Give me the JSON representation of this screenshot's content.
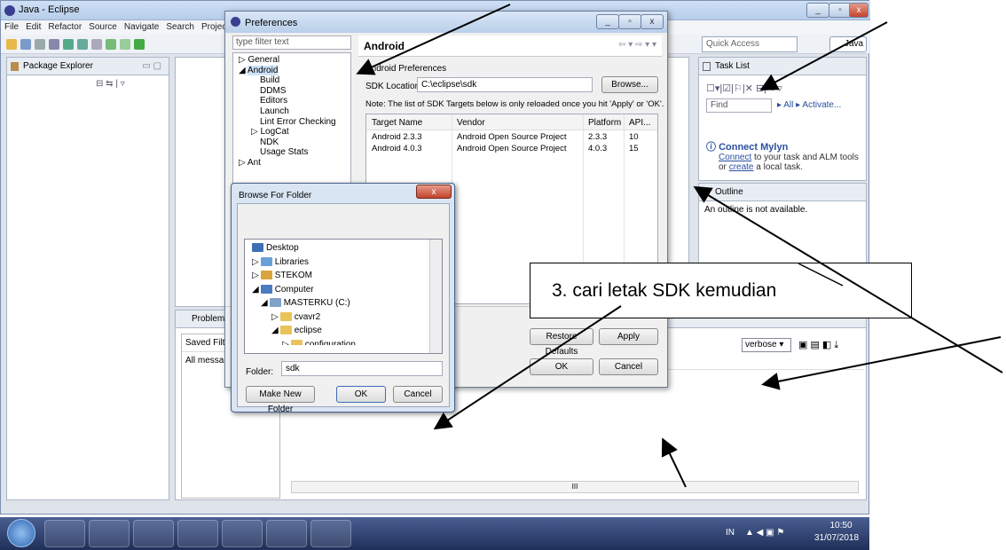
{
  "eclipse": {
    "title": "Java - Eclipse",
    "menu": [
      "File",
      "Edit",
      "Refactor",
      "Source",
      "Navigate",
      "Search",
      "Projec"
    ],
    "quick_access": "Quick Access",
    "perspective": "Java"
  },
  "views": {
    "package_explorer": "Package Explorer",
    "task_list": "Task List",
    "find_placeholder": "Find",
    "all": "All",
    "activate": "Activate...",
    "mylyn_title": "Connect Mylyn",
    "mylyn_link1": "Connect",
    "mylyn_text1": " to your task and ALM tools or",
    "mylyn_link2": "create",
    "mylyn_text2": " a local task.",
    "outline": "Outline",
    "outline_msg": "An outline is not available.",
    "problems": "Problems",
    "saved_filter": "Saved Filte",
    "all_messages": "All messa",
    "verbose": "verbose",
    "scroll_mark": "III"
  },
  "preferences": {
    "title": "Preferences",
    "filter_placeholder": "type filter text",
    "tree": [
      "General",
      "Android",
      "Build",
      "DDMS",
      "Editors",
      "Launch",
      "Lint Error Checking",
      "LogCat",
      "NDK",
      "Usage Stats",
      "Ant"
    ],
    "page_title": "Android",
    "section": "Android Preferences",
    "sdk_label": "SDK Location:",
    "sdk_value": "C:\\eclipse\\sdk",
    "browse": "Browse...",
    "note": "Note: The list of SDK Targets below is only reloaded once you hit 'Apply' or 'OK'.",
    "columns": [
      "Target Name",
      "Vendor",
      "Platform",
      "API..."
    ],
    "rows": [
      [
        "Android 2.3.3",
        "Android Open Source Project",
        "2.3.3",
        "10"
      ],
      [
        "Android 4.0.3",
        "Android Open Source Project",
        "4.0.3",
        "15"
      ]
    ],
    "restore": "Restore Defaults",
    "apply": "Apply",
    "ok": "OK",
    "cancel": "Cancel"
  },
  "browse": {
    "title": "Browse For Folder",
    "tree": [
      "Desktop",
      "Libraries",
      "STEKOM",
      "Computer",
      "MASTERKU (C:)",
      "cvavr2",
      "eclipse",
      "configuration"
    ],
    "folder_label": "Folder:",
    "folder_value": "sdk",
    "new_folder": "Make New Folder",
    "ok": "OK",
    "cancel": "Cancel"
  },
  "callout": "3. cari letak SDK kemudian",
  "tray": {
    "lang": "IN",
    "time": "10:50",
    "date": "31/07/2018"
  }
}
